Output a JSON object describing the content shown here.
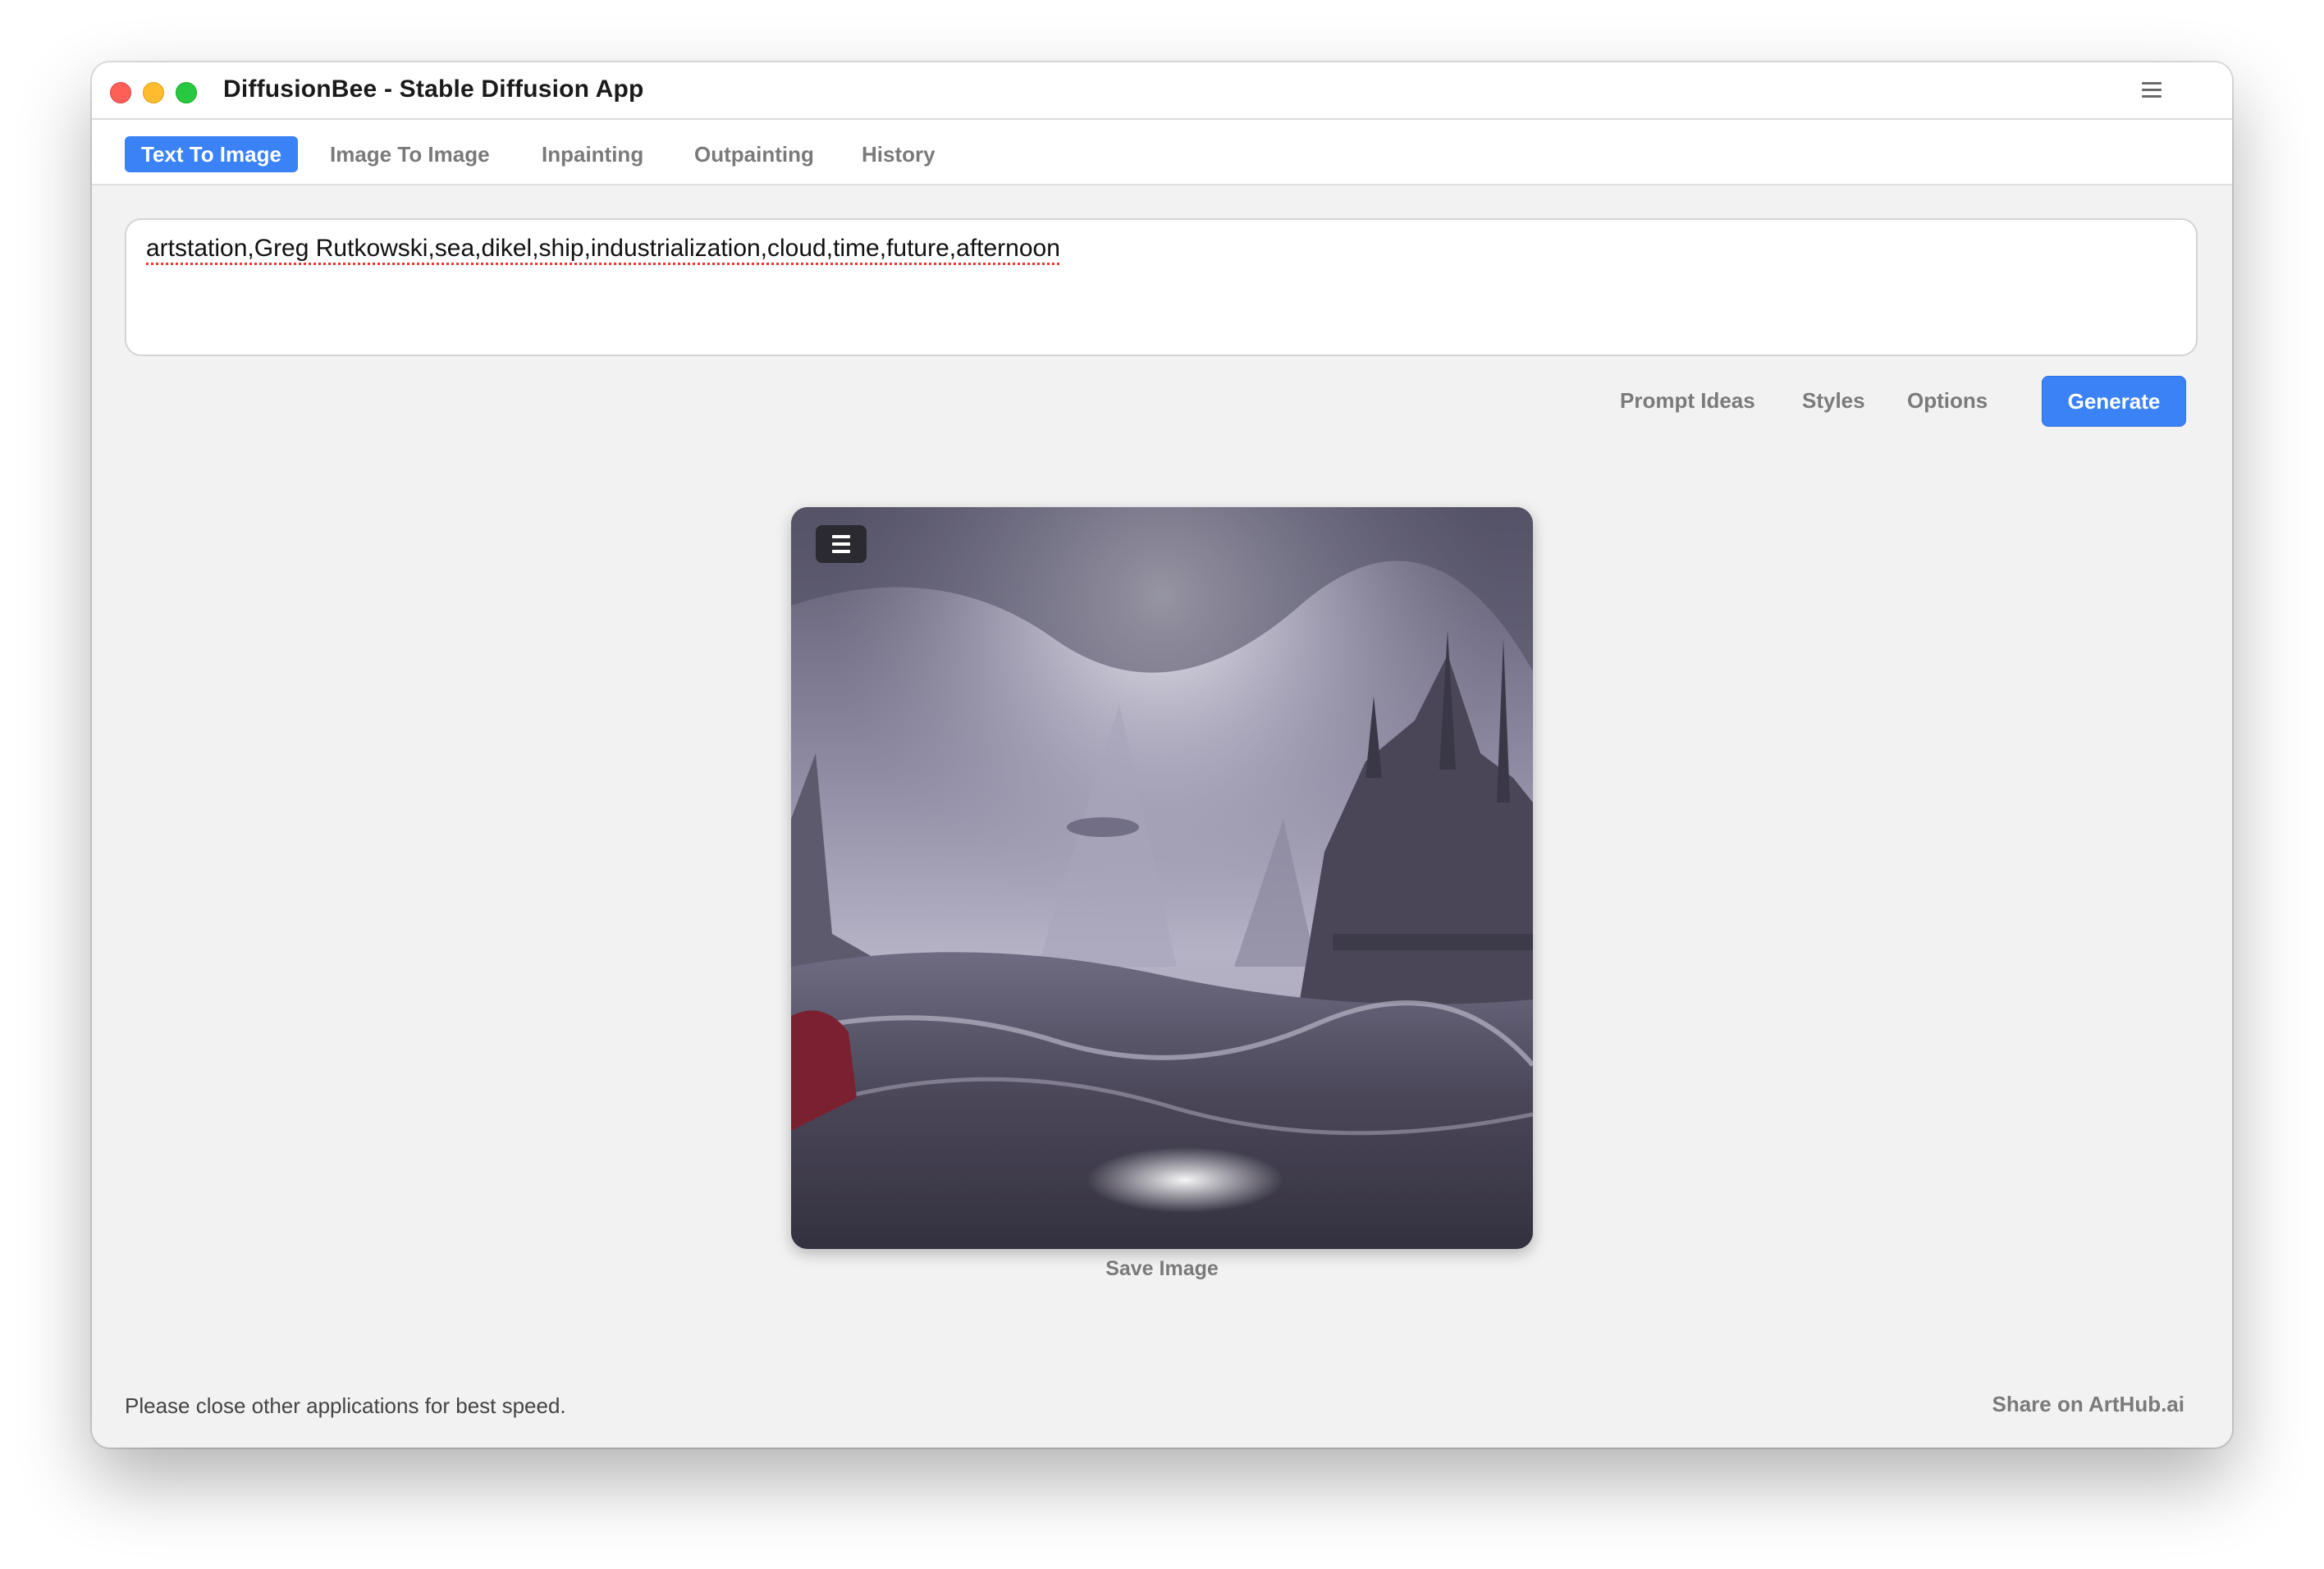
{
  "window": {
    "title": "DiffusionBee - Stable Diffusion App",
    "menu_icon": "hamburger-menu-icon"
  },
  "tabs": [
    {
      "label": "Text To Image",
      "active": true
    },
    {
      "label": "Image To Image",
      "active": false
    },
    {
      "label": "Inpainting",
      "active": false
    },
    {
      "label": "Outpainting",
      "active": false
    },
    {
      "label": "History",
      "active": false
    }
  ],
  "prompt": {
    "value": "artstation,Greg Rutkowski,sea,dikel,ship,industrialization,cloud,time,future,afternoon"
  },
  "actions": {
    "prompt_ideas": "Prompt Ideas",
    "styles": "Styles",
    "options": "Options",
    "generate": "Generate"
  },
  "result": {
    "save_label": "Save Image",
    "menu_icon": "hamburger-menu-icon"
  },
  "footer": {
    "note": "Please close other applications for best speed.",
    "share": "Share on ArtHub.ai"
  },
  "colors": {
    "accent": "#3b82f6",
    "window_bg": "#f2f2f2",
    "tab_inactive": "#7a7a7a"
  }
}
